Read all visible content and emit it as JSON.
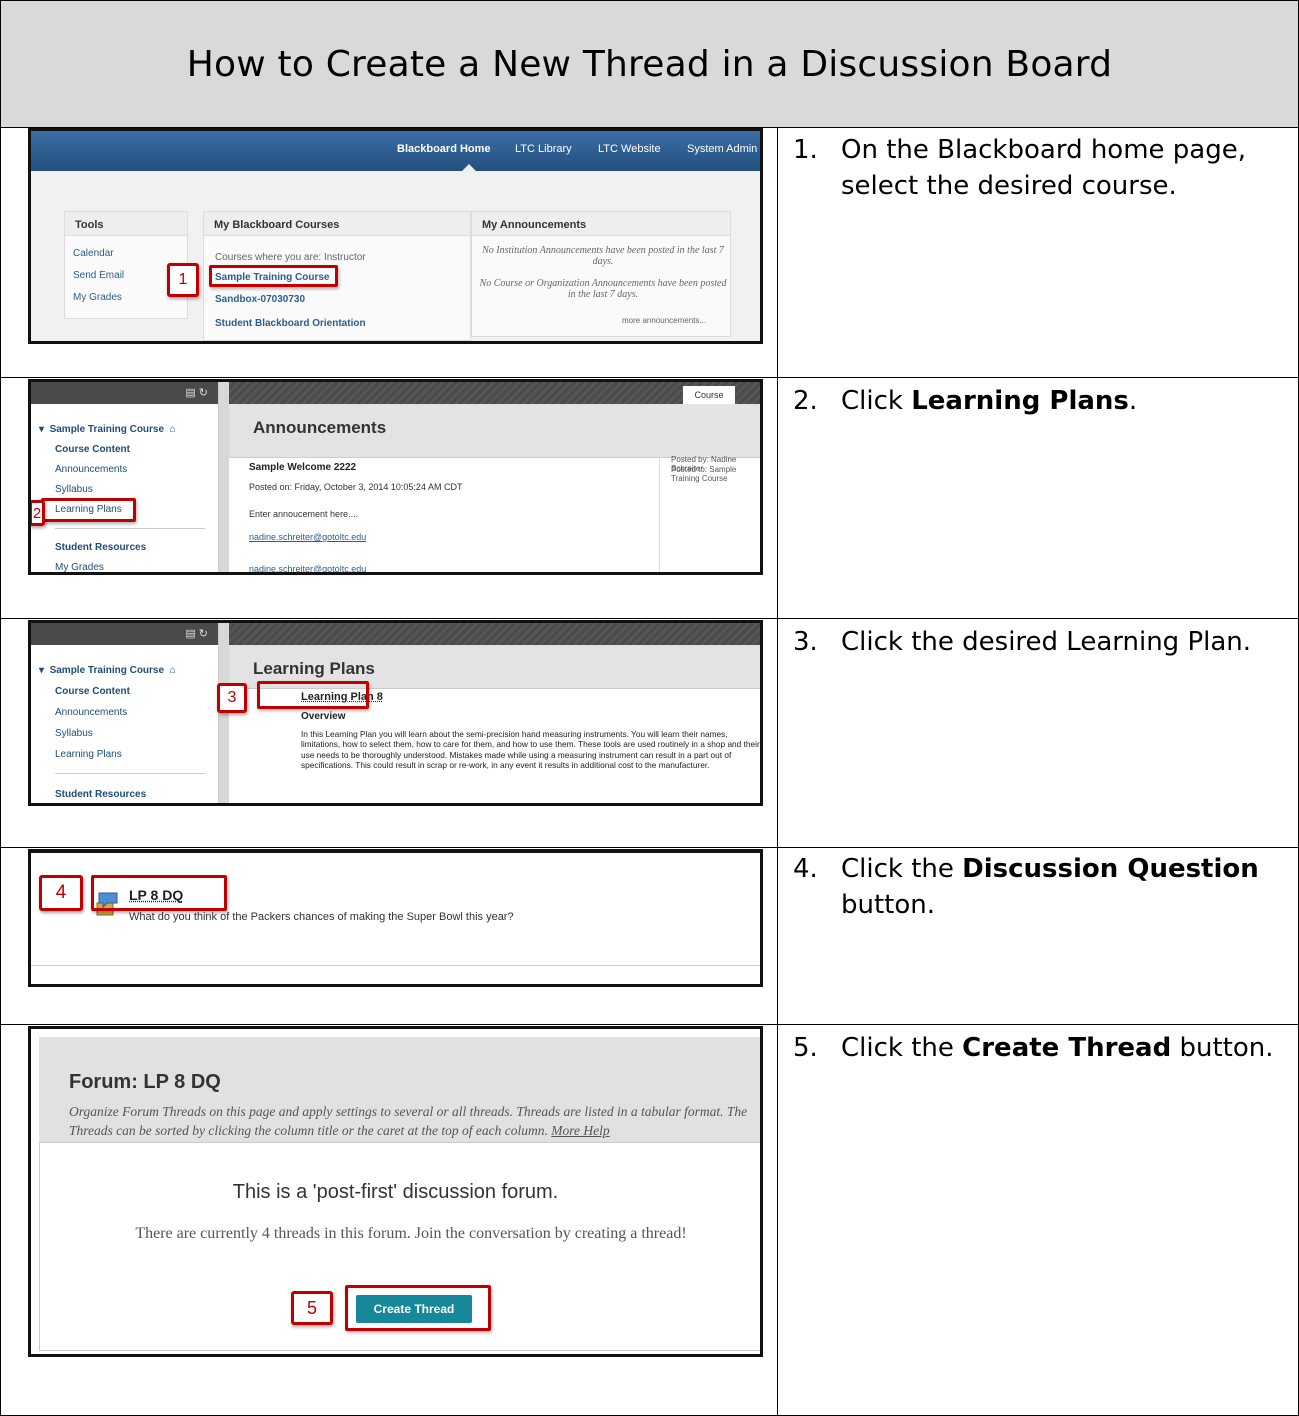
{
  "document": {
    "title": "How to Create a New Thread in a Discussion Board"
  },
  "steps": [
    {
      "num": "1.",
      "text_pre": "On the Blackboard home page, select the desired course.",
      "bold": "",
      "text_post": ""
    },
    {
      "num": "2.",
      "text_pre": "Click ",
      "bold": "Learning Plans",
      "text_post": "."
    },
    {
      "num": "3.",
      "text_pre": "Click the desired Learning Plan.",
      "bold": "",
      "text_post": ""
    },
    {
      "num": "4.",
      "text_pre": "Click the ",
      "bold": "Discussion Question",
      "text_post": " button."
    },
    {
      "num": "5.",
      "text_pre": "Click the ",
      "bold": "Create Thread",
      "text_post": " button."
    }
  ],
  "shot1": {
    "nav": [
      "Blackboard Home",
      "LTC Library",
      "LTC Website",
      "System Admin"
    ],
    "tools_title": "Tools",
    "tools": [
      "Calendar",
      "Send Email",
      "My Grades"
    ],
    "courses_title": "My Blackboard Courses",
    "courses_caption": "Courses where you are: Instructor",
    "courses": [
      "Sample Training Course",
      "Sandbox-07030730",
      "Student Blackboard Orientation"
    ],
    "ann_title": "My Announcements",
    "ann_1": "No Institution Announcements have been posted in the last 7 days.",
    "ann_2": "No Course or Organization Announcements have been posted in the last 7 days.",
    "more": "more announcements...",
    "callout": "1"
  },
  "shot2": {
    "course": "Sample Training Course",
    "menu": [
      "Course Content",
      "Announcements",
      "Syllabus",
      "Learning Plans"
    ],
    "menu_resources": "Student Resources",
    "menu_grades": "My Grades",
    "tab": "Course",
    "heading": "Announcements",
    "post_title": "Sample Welcome 2222",
    "posted_on": "Posted on: Friday, October 3, 2014 10:05:24 AM CDT",
    "body": "Enter annoucement here....",
    "email": "nadine.schreiter@gotoltc.edu",
    "email2": "nadine.schreiter@gotoltc.edu",
    "posted_by": "Posted by: Nadine Schreiter",
    "posted_to": "Posted to: Sample Training Course",
    "callout": "2"
  },
  "shot3": {
    "course": "Sample Training Course",
    "menu": [
      "Course Content",
      "Announcements",
      "Syllabus",
      "Learning Plans"
    ],
    "menu_resources": "Student Resources",
    "heading": "Learning Plans",
    "item": "Learning Plan 8",
    "overview": "Overview",
    "paragraph": "In this Learning Plan you will learn about the semi-precision hand measuring instruments. You will learn their names, limitations, how to select them, how to care for them, and how to use them. These tools are used routinely in a shop and their use needs to be thoroughly understood. Mistakes made while using a measuring instrument can result in a part out of specifications. This could result in scrap or re-work, in any event it results in additional cost to the manufacturer.",
    "callout": "3"
  },
  "shot4": {
    "item": "LP 8 DQ",
    "question": "What do you think of the Packers chances of making the Super Bowl this year?",
    "callout": "4"
  },
  "shot5": {
    "forum_title": "Forum: LP 8 DQ",
    "desc": "Organize Forum Threads on this page and apply settings to several or all threads. Threads are listed in a tabular format. The Threads can be sorted by clicking the column title or the caret at the top of each column.",
    "more_help": "More Help",
    "post_first": "This is a 'post-first' discussion forum.",
    "current": "There are currently 4 threads in this forum. Join the conversation by creating a thread!",
    "button": "Create Thread",
    "callout": "5"
  },
  "colors": {
    "title_bg": "#d9d9d9",
    "callout": "#c00000",
    "bb_blue": "#2b5a8a",
    "button_teal": "#17879a"
  }
}
